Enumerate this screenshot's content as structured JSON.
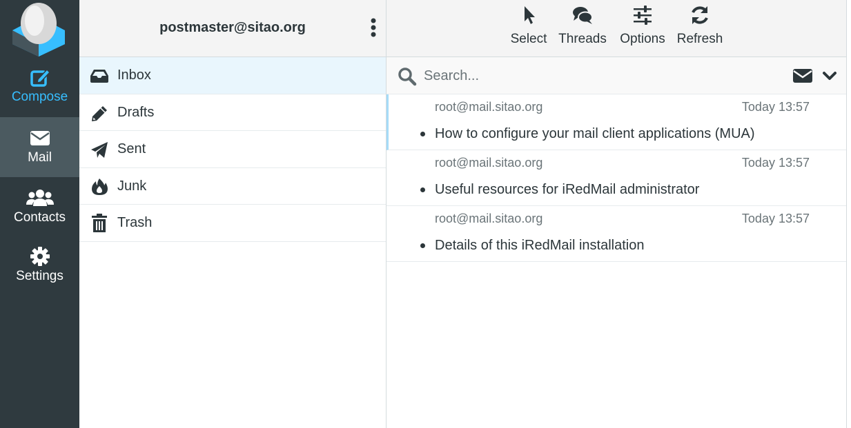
{
  "nav": {
    "compose": "Compose",
    "mail": "Mail",
    "contacts": "Contacts",
    "settings": "Settings",
    "active": "Mail",
    "accent_color": "#37beff",
    "background_color": "#2f3a3f"
  },
  "account": {
    "email": "postmaster@sitao.org"
  },
  "folders": [
    {
      "label": "Inbox",
      "icon": "inbox-icon",
      "active": true
    },
    {
      "label": "Drafts",
      "icon": "pencil-icon"
    },
    {
      "label": "Sent",
      "icon": "paper-plane-icon"
    },
    {
      "label": "Junk",
      "icon": "fire-icon"
    },
    {
      "label": "Trash",
      "icon": "trash-icon"
    }
  ],
  "toolbar": {
    "select": "Select",
    "threads": "Threads",
    "options": "Options",
    "refresh": "Refresh"
  },
  "search": {
    "placeholder": "Search..."
  },
  "messages": [
    {
      "from": "root@mail.sitao.org",
      "date": "Today 13:57",
      "subject": "How to configure your mail client applications (MUA)",
      "selected": true
    },
    {
      "from": "root@mail.sitao.org",
      "date": "Today 13:57",
      "subject": "Useful resources for iRedMail administrator"
    },
    {
      "from": "root@mail.sitao.org",
      "date": "Today 13:57",
      "subject": "Details of this iRedMail installation"
    }
  ]
}
